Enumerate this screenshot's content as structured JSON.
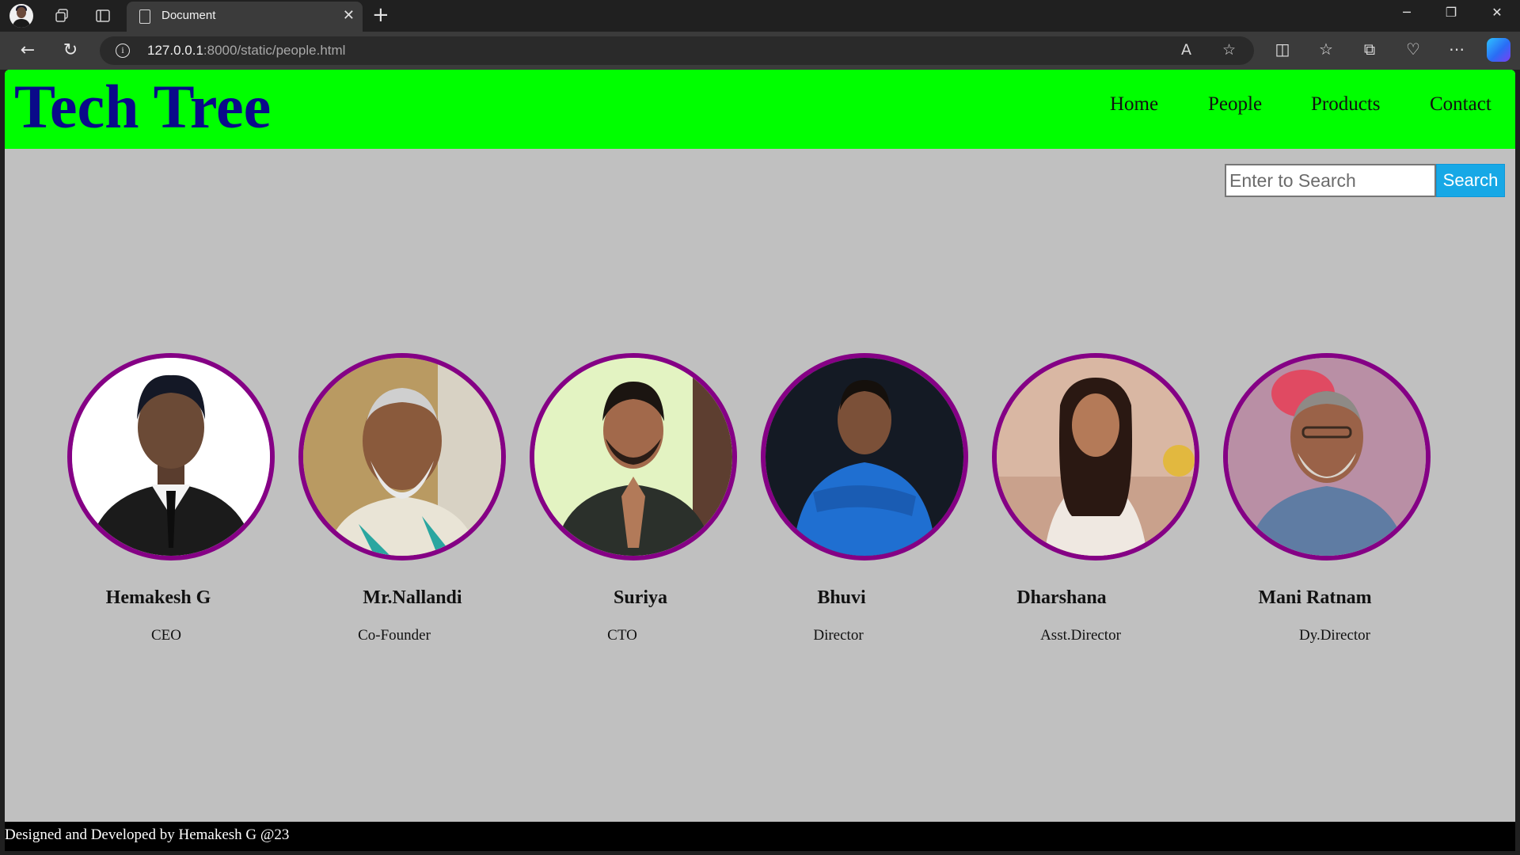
{
  "browser": {
    "tab_title": "Document",
    "url_host": "127.0.0.1",
    "url_rest": ":8000/static/people.html"
  },
  "site": {
    "brand": "Tech Tree",
    "nav": [
      "Home",
      "People",
      "Products",
      "Contact"
    ],
    "search": {
      "placeholder": "Enter to Search",
      "button_label": "Search"
    },
    "people": [
      {
        "name": "Hemakesh G",
        "role": "CEO"
      },
      {
        "name": "Mr.Nallandi",
        "role": "Co-Founder"
      },
      {
        "name": "Suriya",
        "role": "CTO"
      },
      {
        "name": "Bhuvi",
        "role": "Director"
      },
      {
        "name": "Dharshana",
        "role": "Asst.Director"
      },
      {
        "name": "Mani Ratnam",
        "role": "Dy.Director"
      }
    ],
    "footer": "Designed and Developed by Hemakesh G @23"
  },
  "colors": {
    "header_bg": "#00ff00",
    "brand_text": "#0a0a8a",
    "page_bg": "#c0c0c0",
    "photo_border": "#850085",
    "search_button": "#17a8e6",
    "footer_bg": "#000000"
  }
}
